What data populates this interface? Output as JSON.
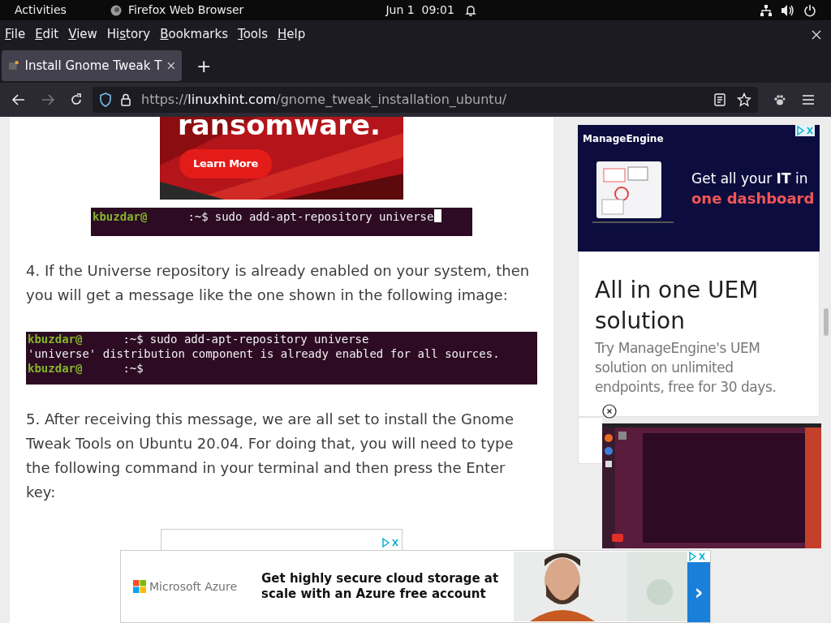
{
  "top_bar": {
    "activities": "Activities",
    "app_name": "Firefox Web Browser",
    "clock": "Jun 1  09:01"
  },
  "menu_bar": [
    {
      "key": "F",
      "after": "ile"
    },
    {
      "key": "E",
      "after": "dit"
    },
    {
      "key": "V",
      "after": "iew"
    },
    {
      "before": "Hi",
      "key": "s",
      "after": "tory"
    },
    {
      "key": "B",
      "after": "ookmarks"
    },
    {
      "key": "T",
      "after": "ools"
    },
    {
      "key": "H",
      "after": "elp"
    }
  ],
  "tabs": [
    {
      "title": "Install Gnome Tweak T",
      "selected": true
    }
  ],
  "new_tab": "+",
  "address_bar": {
    "scheme": "https://",
    "host": "linuxhint.com",
    "path": "/gnome_tweak_installation_ubuntu/"
  },
  "nav": {
    "back_disabled": false,
    "forward_disabled": true
  },
  "article": {
    "banner_ad": {
      "headline": "ransomware.",
      "button": "Learn More"
    },
    "blocks": [
      {
        "kind": "terminal",
        "cursor": true,
        "lines": [
          {
            "kind": "prompt",
            "user": "kbuzdar@",
            "path": ":~$",
            "command": "sudo add-apt-repository universe"
          }
        ]
      },
      {
        "kind": "paragraph",
        "text": "4. If the Universe repository is already enabled on your system, then you will get a message like the one shown in the following image:"
      },
      {
        "kind": "terminal",
        "cursor": false,
        "lines": [
          {
            "kind": "prompt",
            "user": "kbuzdar@",
            "path": ":~$",
            "command": "sudo add-apt-repository universe"
          },
          {
            "kind": "output",
            "text": "'universe' distribution component is already enabled for all sources."
          },
          {
            "kind": "prompt",
            "user": "kbuzdar@",
            "path": ":~$"
          }
        ]
      },
      {
        "kind": "paragraph",
        "text": "5. After receiving this message, we are all set to install the Gnome Tweak Tools on Ubuntu 20.04. For doing that, you will need to type the following command in your terminal and then press the Enter key:"
      }
    ]
  },
  "sidebar_ad": {
    "brand": "ManageEngine",
    "tagline": "Get all your **IT** in",
    "tagline_accent": "one dashboard",
    "title": "All in one UEM solution",
    "body": "Try ManageEngine's UEM solution on unlimited endpoints, free for 30 days."
  },
  "bottom_ad": {
    "brand": "Microsoft Azure",
    "text": "Get highly secure cloud storage at scale with an Azure free account",
    "arrow": "›"
  }
}
